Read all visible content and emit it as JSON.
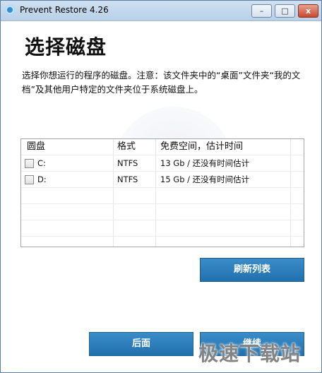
{
  "window": {
    "title": "Prevent Restore 4.26",
    "buttons": {
      "minimize": "–",
      "maximize": "□",
      "close": "x"
    }
  },
  "header": {
    "title": "选择磁盘",
    "description": "选择你想运行的程序的磁盘。注意：该文件夹中的“桌面”文件夹“我的文档”及其他用户特定的文件夹位于系统磁盘上。"
  },
  "disk_table": {
    "columns": [
      "圆盘",
      "格式",
      "免费空间，估计时间"
    ],
    "rows": [
      {
        "name": "C:",
        "format": "NTFS",
        "space": "13 Gb / 还没有时间估计",
        "checked": false
      },
      {
        "name": "D:",
        "format": "NTFS",
        "space": "15 Gb / 还没有时间估计",
        "checked": false
      }
    ]
  },
  "actions": {
    "refresh": "刷新列表",
    "back": "后面",
    "next": "继续"
  },
  "watermark": {
    "text": "极速下载站"
  },
  "colors": {
    "accent": "#2a7fbd",
    "titlebar": "#c2d8ee",
    "close": "#c8482d"
  }
}
